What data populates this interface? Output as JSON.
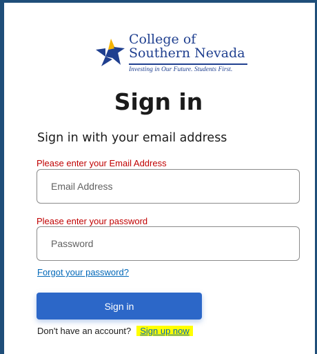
{
  "logo": {
    "line1": "College of",
    "line2": "Southern Nevada",
    "tagline": "Investing in Our Future. Students First."
  },
  "page": {
    "title": "Sign in",
    "subtitle": "Sign in with your email address"
  },
  "form": {
    "email_error": "Please enter your Email Address",
    "email_placeholder": "Email Address",
    "password_error": "Please enter your password",
    "password_placeholder": "Password",
    "forgot_link": "Forgot your password?",
    "signin_label": "Sign in",
    "no_account_text": "Don't have an account?",
    "signup_link": "Sign up now"
  },
  "colors": {
    "brand_blue": "#1f3f8f",
    "brand_gold": "#f5b400",
    "button_blue": "#2c67c8",
    "error_red": "#c00000",
    "link_blue": "#0067b8",
    "highlight": "#ffff00"
  },
  "icons": {
    "logo_mark": "star-pinwheel-icon"
  }
}
